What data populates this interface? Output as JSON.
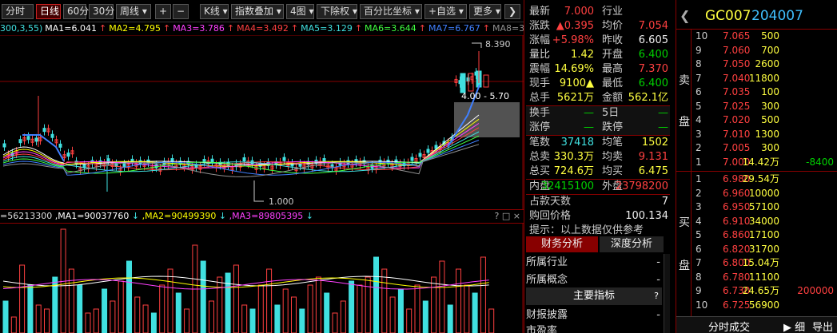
{
  "toolbar": {
    "buttons": [
      "分时",
      "日线",
      "60分",
      "30分",
      "周线 ▾",
      "+",
      "−",
      "K线 ▾",
      "指数叠加 ▾",
      "4图 ▾",
      "下除权 ▾",
      "百分比坐标 ▾",
      "+自选 ▾",
      "更多 ▾",
      "❯"
    ]
  },
  "ma_bar": {
    "prefix": "300,3,55)",
    "items": [
      {
        "label": "MA1=6.041",
        "color": "#ffffff"
      },
      {
        "label": "MA2=4.795",
        "color": "#ffff00"
      },
      {
        "label": "MA3=3.786",
        "color": "#ff40ff"
      },
      {
        "label": "MA4=3.492",
        "color": "#ff4040"
      },
      {
        "label": "MA5=3.129",
        "color": "#40e0e0"
      },
      {
        "label": "MA6=3.644",
        "color": "#40ff40"
      },
      {
        "label": "MA7=6.767",
        "color": "#4080ff"
      },
      {
        "label": "MA8=3.7",
        "color": "#909090"
      }
    ]
  },
  "chart_annotations": {
    "high": "8.390",
    "low": "1.000",
    "range": "4.00 - 5.70"
  },
  "chart_data": {
    "type": "candlestick",
    "high_label": 8.39,
    "low_label": 1.0,
    "last_close": 7.0
  },
  "vol_header": {
    "prefix": "=56213300",
    "items": [
      {
        "label": "MA1=90037760",
        "color": "#ffffff"
      },
      {
        "label": "MA2=90499390",
        "color": "#ffff00"
      },
      {
        "label": "MA3=89805395",
        "color": "#ff40ff"
      }
    ],
    "icons": "? □ ×"
  },
  "quote": {
    "rows": [
      {
        "k": "最新",
        "v": "7.000",
        "vc": "red",
        "k2": "行业",
        "v2": "",
        "v2c": "white"
      },
      {
        "k": "涨跌",
        "v": "▲0.395",
        "vc": "red",
        "k2": "均价",
        "v2": "7.054",
        "v2c": "red"
      },
      {
        "k": "涨幅",
        "v": "+5.98%",
        "vc": "red",
        "k2": "昨收",
        "v2": "6.605",
        "v2c": "white"
      },
      {
        "k": "量比",
        "v": "1.42",
        "vc": "yellow",
        "k2": "开盘",
        "v2": "6.400",
        "v2c": "green"
      },
      {
        "k": "震幅",
        "v": "14.69%",
        "vc": "yellow",
        "k2": "最高",
        "v2": "7.370",
        "v2c": "red"
      },
      {
        "k": "现手",
        "v": "9100▲",
        "vc": "yellow",
        "k2": "最低",
        "v2": "6.400",
        "v2c": "green"
      },
      {
        "k": "总手",
        "v": "5621万",
        "vc": "yellow",
        "k2": "金额",
        "v2": "562.1亿",
        "v2c": "yellow"
      },
      {
        "k": "换手",
        "v": "—",
        "vc": "green",
        "k2": "5日",
        "v2": "—",
        "v2c": "green"
      },
      {
        "k": "涨停",
        "v": "—",
        "vc": "green",
        "k2": "跌停",
        "v2": "—",
        "v2c": "green"
      },
      {
        "k": "笔数",
        "v": "37418",
        "vc": "cyan",
        "k2": "均笔",
        "v2": "1502",
        "v2c": "yellow"
      },
      {
        "k": "总卖",
        "v": "330.3万",
        "vc": "yellow",
        "k2": "均卖",
        "v2": "9.131",
        "v2c": "red"
      },
      {
        "k": "总买",
        "v": "724.6万",
        "vc": "yellow",
        "k2": "均买",
        "v2": "6.475",
        "v2c": "yellow"
      },
      {
        "k": "内盘",
        "v": "32415100",
        "vc": "green",
        "k2": "外盘",
        "v2": "23798200",
        "v2c": "red"
      }
    ],
    "extra": [
      {
        "k": "占款天数",
        "v": "7"
      },
      {
        "k": "购回价格",
        "v": "100.134"
      }
    ],
    "tip": "提示：以上数据仅供参考"
  },
  "tabs": {
    "finance": "财务分析",
    "depth": "深度分析"
  },
  "panel": {
    "industry": "所属行业",
    "concept": "所属概念",
    "main_title": "主要指标",
    "report": "财报披露",
    "pe": "市盈率"
  },
  "orderbook": {
    "code": "GC007",
    "id": "204007",
    "sell_label_1": "卖",
    "sell_label_2": "盘",
    "buy_label_1": "买",
    "buy_label_2": "盘",
    "sells": [
      {
        "lv": "10",
        "pr": "7.065",
        "vol": "500",
        "ex": ""
      },
      {
        "lv": "9",
        "pr": "7.060",
        "vol": "700",
        "ex": ""
      },
      {
        "lv": "8",
        "pr": "7.050",
        "vol": "2600",
        "ex": ""
      },
      {
        "lv": "7",
        "pr": "7.040",
        "vol": "11800",
        "ex": ""
      },
      {
        "lv": "6",
        "pr": "7.035",
        "vol": "100",
        "ex": ""
      },
      {
        "lv": "5",
        "pr": "7.025",
        "vol": "300",
        "ex": ""
      },
      {
        "lv": "4",
        "pr": "7.020",
        "vol": "500",
        "ex": ""
      },
      {
        "lv": "3",
        "pr": "7.010",
        "vol": "1300",
        "ex": ""
      },
      {
        "lv": "2",
        "pr": "7.005",
        "vol": "300",
        "ex": ""
      },
      {
        "lv": "1",
        "pr": "7.000",
        "vol": "14.42万",
        "ex": "-8400"
      }
    ],
    "buys": [
      {
        "lv": "1",
        "pr": "6.980",
        "vol": "29.54万",
        "ex": ""
      },
      {
        "lv": "2",
        "pr": "6.960",
        "vol": "10000",
        "ex": ""
      },
      {
        "lv": "3",
        "pr": "6.950",
        "vol": "57100",
        "ex": ""
      },
      {
        "lv": "4",
        "pr": "6.910",
        "vol": "34000",
        "ex": ""
      },
      {
        "lv": "5",
        "pr": "6.860",
        "vol": "17100",
        "ex": ""
      },
      {
        "lv": "6",
        "pr": "6.820",
        "vol": "31700",
        "ex": ""
      },
      {
        "lv": "7",
        "pr": "6.800",
        "vol": "15.04万",
        "ex": ""
      },
      {
        "lv": "8",
        "pr": "6.780",
        "vol": "11100",
        "ex": ""
      },
      {
        "lv": "9",
        "pr": "6.730",
        "vol": "24.65万",
        "ex": "200000"
      },
      {
        "lv": "10",
        "pr": "6.725",
        "vol": "56900",
        "ex": ""
      }
    ],
    "bottom": {
      "time": "分时成交",
      "detail": "细",
      "export": "导出"
    }
  }
}
